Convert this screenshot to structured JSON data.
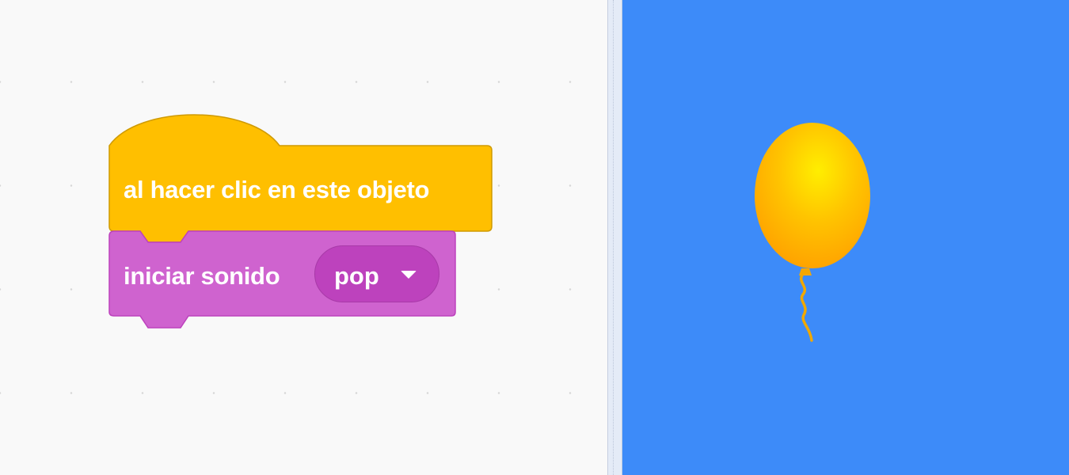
{
  "workspace": {
    "hat_block": {
      "label": "al hacer clic en este objeto",
      "category": "events",
      "color": "#FFBF00"
    },
    "command_block": {
      "label": "iniciar sonido",
      "category": "sound",
      "color": "#CF63CF",
      "sound_menu": {
        "selected": "pop",
        "icon": "caret-down-icon"
      }
    }
  },
  "stage": {
    "background_color": "#3D8BF9",
    "sprite": {
      "kind": "balloon",
      "color": "#FFC000"
    }
  }
}
